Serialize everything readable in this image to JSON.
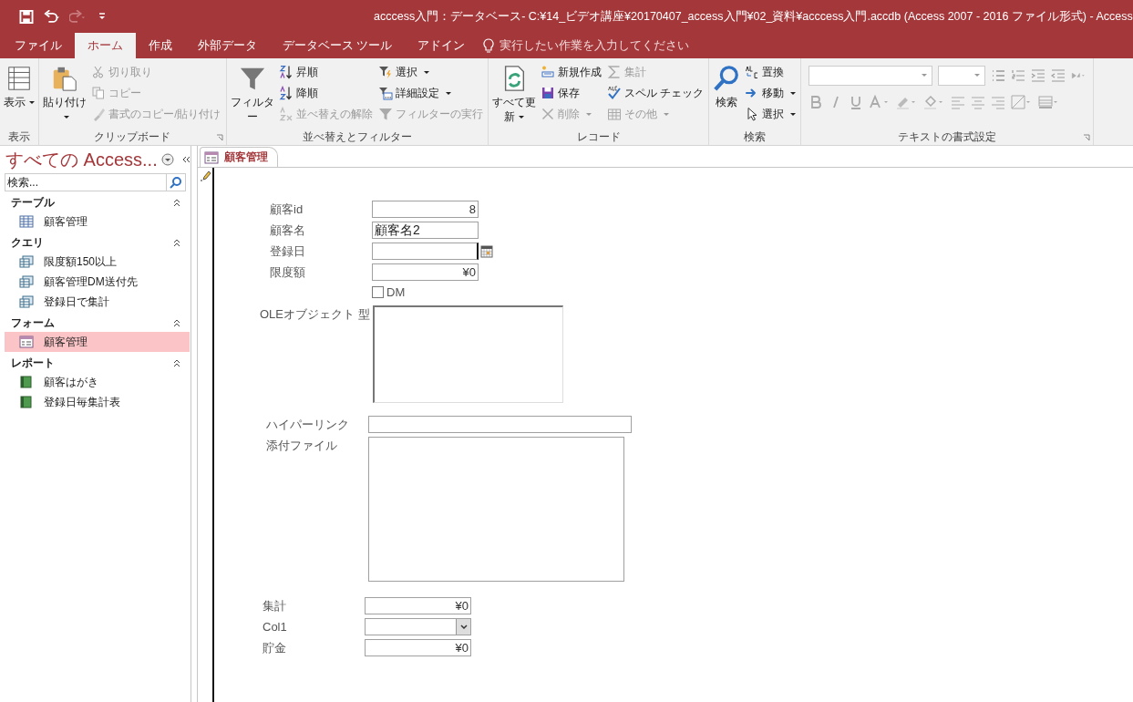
{
  "window": {
    "title": "acccess入門：データベース- C:¥14_ビデオ講座¥20170407_access入門¥02_資料¥acccess入門.accdb (Access 2007 - 2016 ファイル形式)  -  Access"
  },
  "tabs": [
    {
      "label": "ファイル",
      "selected": false
    },
    {
      "label": "ホーム",
      "selected": true
    },
    {
      "label": "作成",
      "selected": false
    },
    {
      "label": "外部データ",
      "selected": false
    },
    {
      "label": "データベース ツール",
      "selected": false
    },
    {
      "label": "アドイン",
      "selected": false
    }
  ],
  "tell_me": {
    "placeholder": "実行したい作業を入力してください"
  },
  "ribbon": [
    {
      "kind": "buttons",
      "label": "表示",
      "launcher": false,
      "columns": [
        [
          {
            "kind": "large",
            "label": "表示",
            "dropdown": true,
            "disabled": false
          }
        ]
      ]
    },
    {
      "kind": "buttons",
      "label": "クリップボード",
      "launcher": true,
      "columns": [
        [
          {
            "kind": "large",
            "label": "貼り付け",
            "dropdown": true,
            "disabled": false
          }
        ],
        [
          {
            "kind": "small",
            "label": "切り取り",
            "dropdown": false,
            "disabled": true
          },
          {
            "kind": "small",
            "label": "コピー",
            "dropdown": false,
            "disabled": true
          },
          {
            "kind": "small",
            "label": "書式のコピー/貼り付け",
            "dropdown": false,
            "disabled": true
          }
        ]
      ]
    },
    {
      "kind": "buttons",
      "label": "並べ替えとフィルター",
      "launcher": false,
      "columns": [
        [
          {
            "kind": "large",
            "label": "フィルター",
            "dropdown": false,
            "disabled": false
          }
        ],
        [
          {
            "kind": "small",
            "label": "昇順",
            "dropdown": false,
            "disabled": false
          },
          {
            "kind": "small",
            "label": "降順",
            "dropdown": false,
            "disabled": false
          },
          {
            "kind": "small",
            "label": "並べ替えの解除",
            "dropdown": false,
            "disabled": true
          }
        ],
        [
          {
            "kind": "small",
            "label": "選択",
            "dropdown": true,
            "disabled": false
          },
          {
            "kind": "small",
            "label": "詳細設定",
            "dropdown": true,
            "disabled": false
          },
          {
            "kind": "small",
            "label": "フィルターの実行",
            "dropdown": false,
            "disabled": true
          }
        ]
      ]
    },
    {
      "kind": "buttons",
      "label": "レコード",
      "launcher": false,
      "columns": [
        [
          {
            "kind": "large",
            "label": "すべて更新",
            "dropdown": true,
            "disabled": false
          }
        ],
        [
          {
            "kind": "small",
            "label": "新規作成",
            "dropdown": false,
            "disabled": false
          },
          {
            "kind": "small",
            "label": "保存",
            "dropdown": false,
            "disabled": false
          },
          {
            "kind": "small",
            "label": "削除",
            "dropdown": true,
            "disabled": true
          }
        ],
        [
          {
            "kind": "small",
            "label": "集計",
            "dropdown": false,
            "disabled": true
          },
          {
            "kind": "small",
            "label": "スペル チェック",
            "dropdown": false,
            "disabled": false
          },
          {
            "kind": "small",
            "label": "その他",
            "dropdown": true,
            "disabled": true
          }
        ]
      ]
    },
    {
      "kind": "buttons",
      "label": "検索",
      "launcher": false,
      "columns": [
        [
          {
            "kind": "large",
            "label": "検索",
            "dropdown": false,
            "disabled": false
          }
        ],
        [
          {
            "kind": "small",
            "label": "置換",
            "dropdown": false,
            "disabled": false
          },
          {
            "kind": "small",
            "label": "移動",
            "dropdown": true,
            "disabled": false
          },
          {
            "kind": "small",
            "label": "選択",
            "dropdown": true,
            "disabled": false
          }
        ]
      ]
    },
    {
      "kind": "format",
      "label": "テキストの書式設定",
      "launcher": true
    }
  ],
  "nav": {
    "title": "すべての Access...",
    "search": {
      "placeholder": "検索..."
    },
    "groups": [
      {
        "label": "テーブル",
        "kind": "table",
        "expanded": true,
        "items": [
          {
            "label": "顧客管理",
            "selected": false
          }
        ]
      },
      {
        "label": "クエリ",
        "kind": "query",
        "expanded": true,
        "items": [
          {
            "label": "限度額150以上",
            "selected": false
          },
          {
            "label": "顧客管理DM送付先",
            "selected": false
          },
          {
            "label": "登録日で集計",
            "selected": false
          }
        ]
      },
      {
        "label": "フォーム",
        "kind": "form",
        "expanded": true,
        "items": [
          {
            "label": "顧客管理",
            "selected": true
          }
        ]
      },
      {
        "label": "レポート",
        "kind": "report",
        "expanded": true,
        "items": [
          {
            "label": "顧客はがき",
            "selected": false
          },
          {
            "label": "登録日毎集計表",
            "selected": false
          }
        ]
      }
    ]
  },
  "document_tabs": [
    {
      "label": "顧客管理",
      "selected": true
    }
  ],
  "form": {
    "sections": [
      {
        "fields": [
          {
            "kind": "number",
            "label": "顧客id",
            "value": "8"
          },
          {
            "kind": "text",
            "label": "顧客名",
            "value": "顧客名2"
          },
          {
            "kind": "date",
            "label": "登録日"
          },
          {
            "kind": "number",
            "label": "限度額",
            "value": "¥0"
          },
          {
            "kind": "checkbox",
            "label": "DM",
            "checked": false
          }
        ]
      },
      {
        "fields": [
          {
            "kind": "ole",
            "label": "OLEオブジェクト 型"
          }
        ]
      },
      {
        "fields": [
          {
            "kind": "hyperlink",
            "label": "ハイパーリンク"
          },
          {
            "kind": "attachment",
            "label": "添付ファイル"
          }
        ]
      },
      {
        "fields": [
          {
            "kind": "number",
            "label": "集計",
            "value": "¥0"
          },
          {
            "kind": "combo",
            "label": "Col1"
          },
          {
            "kind": "number",
            "label": "貯金",
            "value": "¥0"
          }
        ]
      }
    ]
  }
}
